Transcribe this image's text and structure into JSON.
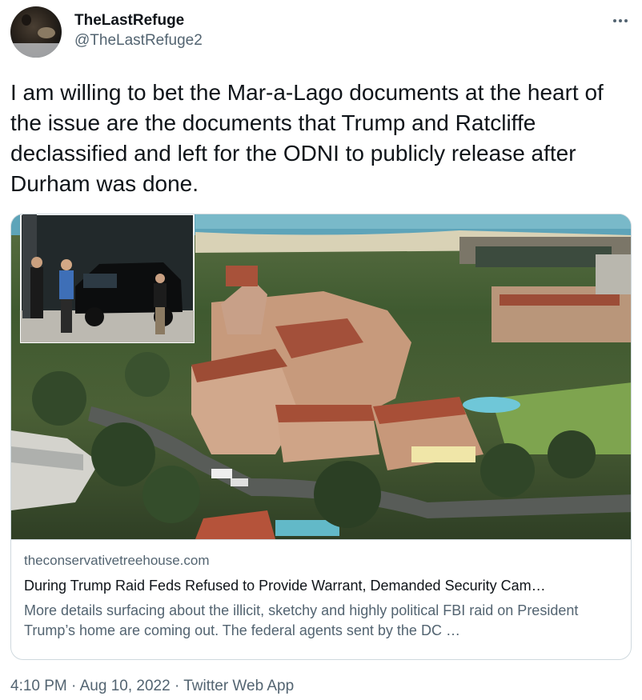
{
  "author": {
    "display_name": "TheLastRefuge",
    "handle": "@TheLastRefuge2"
  },
  "tweet": {
    "text": "I am willing to bet the Mar-a-Lago documents at the heart of the issue are the documents that Trump and Ratcliffe declassified and left for the ODNI to publicly release after Durham was done."
  },
  "card": {
    "domain": "theconservativetreehouse.com",
    "title": "During Trump Raid Feds Refused to Provide Warrant, Demanded Security Cam…",
    "description": "More details surfacing about the illicit, sketchy and highly political FBI raid on President Trump’s home are coming out.  The federal agents sent by the DC …"
  },
  "meta": {
    "time": "4:10 PM",
    "separator": "·",
    "date": "Aug 10, 2022",
    "source": "Twitter Web App"
  },
  "icons": {
    "more": "more-horizontal-icon"
  }
}
